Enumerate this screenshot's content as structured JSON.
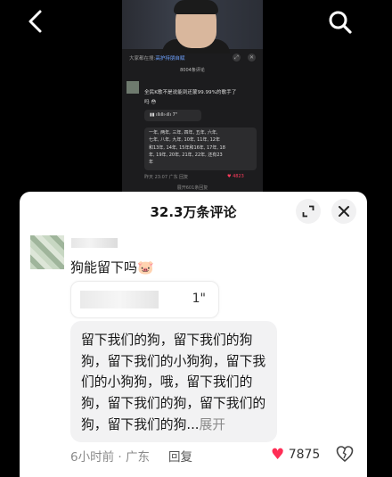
{
  "video": {
    "search_prefix": "大家都在搜:",
    "search_term": "高护持朋自赋",
    "comment_count_label": "8004条评论",
    "comment_line1": "全民K歌不是说能到还蒙99.99%的歌手了",
    "comment_line2": "吗",
    "voice_duration": "7\"",
    "list_lines": [
      "一年, 两年, 三年, 四年, 五年, 六年,",
      "七年, 八年, 九年, 10年, 11年, 12年",
      "和13年, 14年, 15年和16年, 17年, 18",
      "年, 19年, 20年, 21年, 22年, 还有23",
      "年"
    ],
    "list_footer": "昨天 23:07  广东  回复",
    "list_likes": "♥ 4823",
    "expand_label": "展开601条回复"
  },
  "sheet": {
    "title": "32.3万条评论",
    "comment": {
      "text": "狗能留下吗🐷",
      "voice_duration": "1\"",
      "body": "留下我们的狗，留下我们的狗狗，留下我们的小狗狗，留下我们的小狗狗，哦，留下我们的狗，留下我们的狗，留下我们的狗，留下我们的狗...",
      "expand": "展开",
      "time_location": "6小时前 · 广东",
      "reply_label": "回复",
      "like_count": "7875"
    }
  }
}
